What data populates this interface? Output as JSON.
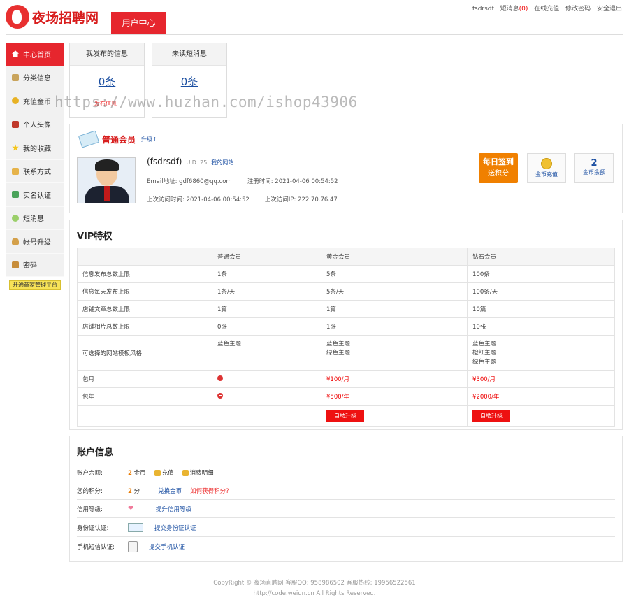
{
  "header": {
    "logo_text": "夜场招聘网",
    "active_tab": "用户中心",
    "user": "fsdrsdf",
    "links": {
      "messages": "短消息",
      "messages_count": "(0)",
      "recharge": "在线充值",
      "change_password": "修改密码",
      "logout": "安全退出"
    }
  },
  "sidebar": {
    "items": [
      {
        "label": "中心首页",
        "icon": "home-icon"
      },
      {
        "label": "分类信息",
        "icon": "edit-icon"
      },
      {
        "label": "充值金币",
        "icon": "coins-icon"
      },
      {
        "label": "个人头像",
        "icon": "portrait-icon"
      },
      {
        "label": "我的收藏",
        "icon": "star-icon"
      },
      {
        "label": "联系方式",
        "icon": "contact-card-icon"
      },
      {
        "label": "实名认证",
        "icon": "id-verify-icon"
      },
      {
        "label": "短消息",
        "icon": "message-icon"
      },
      {
        "label": "帐号升级",
        "icon": "user-upgrade-icon"
      },
      {
        "label": "密码",
        "icon": "lock-icon"
      }
    ],
    "merchant_button": "开通商家管理平台"
  },
  "stats": {
    "published": {
      "title": "我发布的信息",
      "value": "0条",
      "sub": "发布信息"
    },
    "unread": {
      "title": "未读短消息",
      "value": "0条"
    }
  },
  "watermark": "https://www.huzhan.com/ishop43906",
  "member": {
    "level": "普通会员",
    "upgrade": "升级↑",
    "username": "(fsdrsdf)",
    "uid": "UID: 25",
    "my_site": "我的网站",
    "email": "Email地址: gdf6860@qq.com",
    "register_time": "注册时间: 2021-04-06 00:54:52",
    "last_visit_time": "上次访问时间: 2021-04-06 00:54:52",
    "last_visit_ip": "上次访问IP: 222.70.76.47",
    "signin_line1": "每日签到",
    "signin_line2": "送积分",
    "coin_recharge": "金币充值",
    "coin_balance_value": "2",
    "coin_balance_label": "金币余额"
  },
  "vip": {
    "title": "VIP特权",
    "headers": [
      "",
      "普通会员",
      "黄金会员",
      "钻石会员"
    ],
    "rows": [
      [
        "信息发布总数上限",
        "1条",
        "5条",
        "100条"
      ],
      [
        "信息每天发布上限",
        "1条/天",
        "5条/天",
        "100条/天"
      ],
      [
        "店铺文章总数上限",
        "1篇",
        "1篇",
        "10篇"
      ],
      [
        "店铺相片总数上限",
        "0张",
        "1张",
        "10张"
      ]
    ],
    "theme_row": {
      "label": "可选择的网站模板风格",
      "normal": "蓝色主题",
      "gold": [
        "蓝色主题",
        "绿色主题"
      ],
      "diamond": [
        "蓝色主题",
        "橙红主题",
        "绿色主题"
      ]
    },
    "monthly": {
      "label": "包月",
      "gold": "¥100/月",
      "diamond": "¥300/月"
    },
    "yearly": {
      "label": "包年",
      "gold": "¥500/年",
      "diamond": "¥2000/年"
    },
    "upgrade_button": "自助升级"
  },
  "account": {
    "title": "账户信息",
    "balance_label": "账户余额:",
    "balance_value": "2",
    "balance_unit": "金币",
    "recharge": "充值",
    "consume_detail": "消费明细",
    "points_label": "您的积分:",
    "points_value": "2",
    "points_unit": "分",
    "exchange": "兑换金币",
    "how_points": "如何获得积分?",
    "credit_label": "信用等级:",
    "credit_link": "提升信用等级",
    "id_label": "身份证认证:",
    "id_link": "提交身份证认证",
    "phone_label": "手机短信认证:",
    "phone_link": "提交手机认证"
  },
  "footer": {
    "line1": "CopyRight © 夜场直聘网 客服QQ: 958986502 客服热线: 19956522561",
    "line2": "http://code.weiun.cn All Rights Reserved."
  }
}
